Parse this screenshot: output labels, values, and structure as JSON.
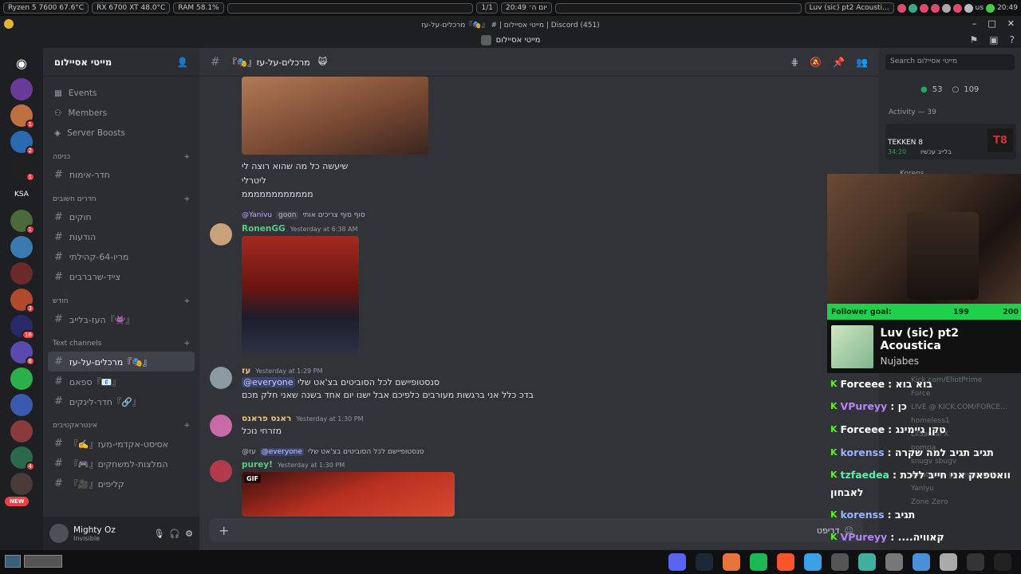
{
  "sysbar": {
    "cpu": "Ryzen 5 7600  67.6°C",
    "gpu": "RX 6700 XT  48.0°C",
    "ram": "RAM   58.1%",
    "workspace": "1/1",
    "clock": "20:49 יום ה׳",
    "media_title": "Luv (sic) pt2 Acousti...",
    "lang": "us",
    "time": "20:49"
  },
  "window": {
    "title": "מייטי אסיילום | # 『🎭』מרכלים-על-עז | Discord (451)",
    "server_bar": "מייטי אסיילום"
  },
  "guilds": [
    {
      "label": "",
      "badge": ""
    },
    {
      "label": "",
      "badge": ""
    },
    {
      "label": "",
      "badge": "1"
    },
    {
      "label": "",
      "badge": "2"
    },
    {
      "label": "",
      "badge": "1"
    },
    {
      "label": "KSA",
      "badge": ""
    },
    {
      "label": "",
      "badge": "1"
    },
    {
      "label": "",
      "badge": ""
    },
    {
      "label": "",
      "badge": ""
    },
    {
      "label": "",
      "badge": "3"
    },
    {
      "label": "",
      "badge": "16"
    },
    {
      "label": "",
      "badge": "8"
    },
    {
      "label": "",
      "badge": ""
    },
    {
      "label": "",
      "badge": ""
    },
    {
      "label": "",
      "badge": ""
    },
    {
      "label": "",
      "badge": "4"
    },
    {
      "label": "",
      "badge": ""
    }
  ],
  "new_badge": "NEW",
  "sidebar": {
    "server_name": "מייטי אסיילום",
    "nav": [
      "Events",
      "Members",
      "Server Boosts"
    ],
    "categories": [
      {
        "name": "כניסה",
        "channels": [
          "חדר-אימות"
        ]
      },
      {
        "name": "חדרים חשובים",
        "channels": [
          "חוקים",
          "הודעות",
          "מריו-64-קהילתי",
          "צייד-שרברבים"
        ]
      },
      {
        "name": "חודש",
        "channels": [
          "『👾』העז-בלייב"
        ]
      },
      {
        "name": "Text channels",
        "channels": [
          "『🎭』מרכלים-על-עז",
          "『📧』ספאם",
          "『🔗』חדר-לינקים"
        ]
      },
      {
        "name": "אינטראקטיבים",
        "channels": [
          "אסיסט-אקדמי-מעז『✍️』",
          "המלצות-למשחקים『🎮』",
          "קליפים『🎥』"
        ]
      }
    ],
    "user": {
      "name": "Mighty Oz",
      "status": "Invisible"
    }
  },
  "chat": {
    "channel": "『🎭』מרכלים-על-עז",
    "header_emoji": "🙀",
    "messages": [
      {
        "text": [
          "שיעשה כל מה שהוא רוצה לי",
          "ליטרלי",
          "ממממממממממממ"
        ]
      },
      {
        "reply": "@Yanivu",
        "reply_badge": "goon",
        "reply_text": "סוף סוף צריכים אותי",
        "author": "RonenGG",
        "time": "Yesterday at 6:38 AM"
      },
      {
        "author": "עז",
        "time": "Yesterday at 1:29 PM",
        "mention": "@everyone",
        "line1": "סנסטופיישם לכל הסוביטים בצ'אט שלי",
        "line2": "בדכ כלל אני ברגשות מעורבים כלפיכם אבל ישנו יום אחד בשנה שאני חלק מכם"
      },
      {
        "author": "ראנס פראנס",
        "time": "Yesterday at 1:30 PM",
        "text": "מזרחי נוכל"
      },
      {
        "reply": "@עז",
        "reply_mention": "@everyone",
        "reply_text": "סנסטופיישם לכל הסוביטים בצ'אט שלי",
        "author": "purey!",
        "time": "Yesterday at 1:30 PM",
        "gif": "GIF"
      }
    ],
    "composer_placeholder": "דריפט"
  },
  "members": {
    "search_placeholder": "Search מייטי אסיילום",
    "online": "53",
    "offline": "109",
    "activity": "Activity — 39",
    "game": "TEKKEN 8",
    "game_time": "34:20",
    "game_sub": "בלייב עכשיו",
    "partial_name": "Korens"
  },
  "overlay": {
    "goal_label": "Follower goal:",
    "goal_current": "199",
    "goal_target": "200",
    "goal_progress": 0.995,
    "song": "Luv (sic) pt2 Acoustica",
    "artist": "Nujabes",
    "chat": [
      {
        "user": "Forceee",
        "msg": "בוא בוא :",
        "color": "#ffffff"
      },
      {
        "user": "VPureyy",
        "msg": "כן :",
        "color": "#b784ff"
      },
      {
        "user": "Forceee",
        "msg": "טקן גיימינג :",
        "color": "#ffffff"
      },
      {
        "user": "korenss",
        "msg": "תגיב תגיב למה שקרה :",
        "color": "#9ab4ff"
      },
      {
        "user": "tzfaedea",
        "msg": "וואטפאק אני חייב ללכת :",
        "color": "#56f0a6"
      },
      {
        "user": "",
        "msg": "לאבחון",
        "color": "#ffffff"
      },
      {
        "user": "korenss",
        "msg": "תגיב :",
        "color": "#9ab4ff"
      },
      {
        "user": "VPureyy",
        "msg": "קאוויה.... :",
        "color": "#b784ff"
      }
    ],
    "bg_users": [
      "Kick.com/EliotPrime",
      "Force",
      "LIVE @ KICK.COM/FORCE...",
      "homeless1",
      "LilSantaFX",
      "pompa",
      "snugv sbugv",
      "whatever. go my scarab",
      "Yaniyu",
      "Zone Zero"
    ]
  }
}
